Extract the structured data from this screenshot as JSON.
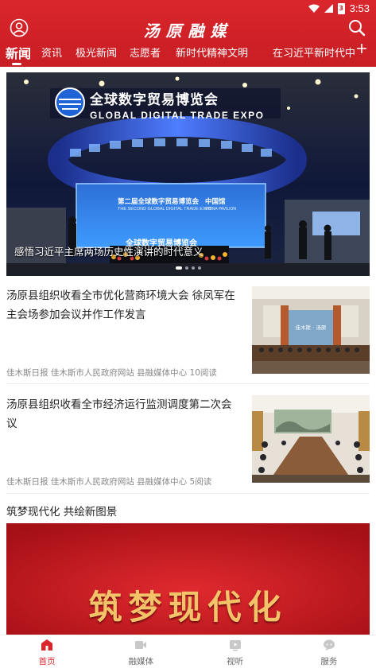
{
  "status_bar": {
    "time": "3:53",
    "battery": "3"
  },
  "header": {
    "title": "汤原融媒"
  },
  "tabs": [
    {
      "label": "新闻",
      "active": true
    },
    {
      "label": "资讯"
    },
    {
      "label": "极光新闻"
    },
    {
      "label": "志愿者"
    },
    {
      "label": "新时代精神文明"
    },
    {
      "label": "在习近平新时代中"
    }
  ],
  "banner": {
    "caption": "感悟习近平主席两场历史性演讲的时代意义",
    "sign_text": "全球数字贸易博览会",
    "sign_text_en": "GLOBAL DIGITAL TRADE EXPO",
    "screen_text": "第二届全球数字贸易博览会",
    "screen_text_en": "THE SECOND GLOBAL DIGITAL TRADE EXPO",
    "screen_pavilion": "中国馆",
    "screen_pavilion_en": "CHINA PAVILION",
    "podium_text": "全球数字贸易博览会"
  },
  "news": [
    {
      "title": "汤原县组织收看全市优化营商环境大会 徐凤军在主会场参加会议并作工作发言",
      "meta": "佳木斯日报 佳木斯市人民政府网站 县融媒体中心  10阅读",
      "thumb_sign": "佳木斯 · 汤原"
    },
    {
      "title": "汤原县组织收看全市经济运行监测调度第二次会议",
      "meta": "佳木斯日报 佳木斯市人民政府网站 县融媒体中心  5阅读"
    }
  ],
  "section": {
    "title": "筑梦现代化 共绘新图景"
  },
  "promo": {
    "text": "筑梦现代化"
  },
  "bottom_nav": [
    {
      "label": "首页",
      "icon": "home-icon",
      "active": true
    },
    {
      "label": "融媒体",
      "icon": "video-camera-icon"
    },
    {
      "label": "视听",
      "icon": "play-icon"
    },
    {
      "label": "服务",
      "icon": "service-chat-icon"
    }
  ],
  "colors": {
    "brand_red": "#d9262c",
    "text": "#222222",
    "meta": "#888888"
  }
}
